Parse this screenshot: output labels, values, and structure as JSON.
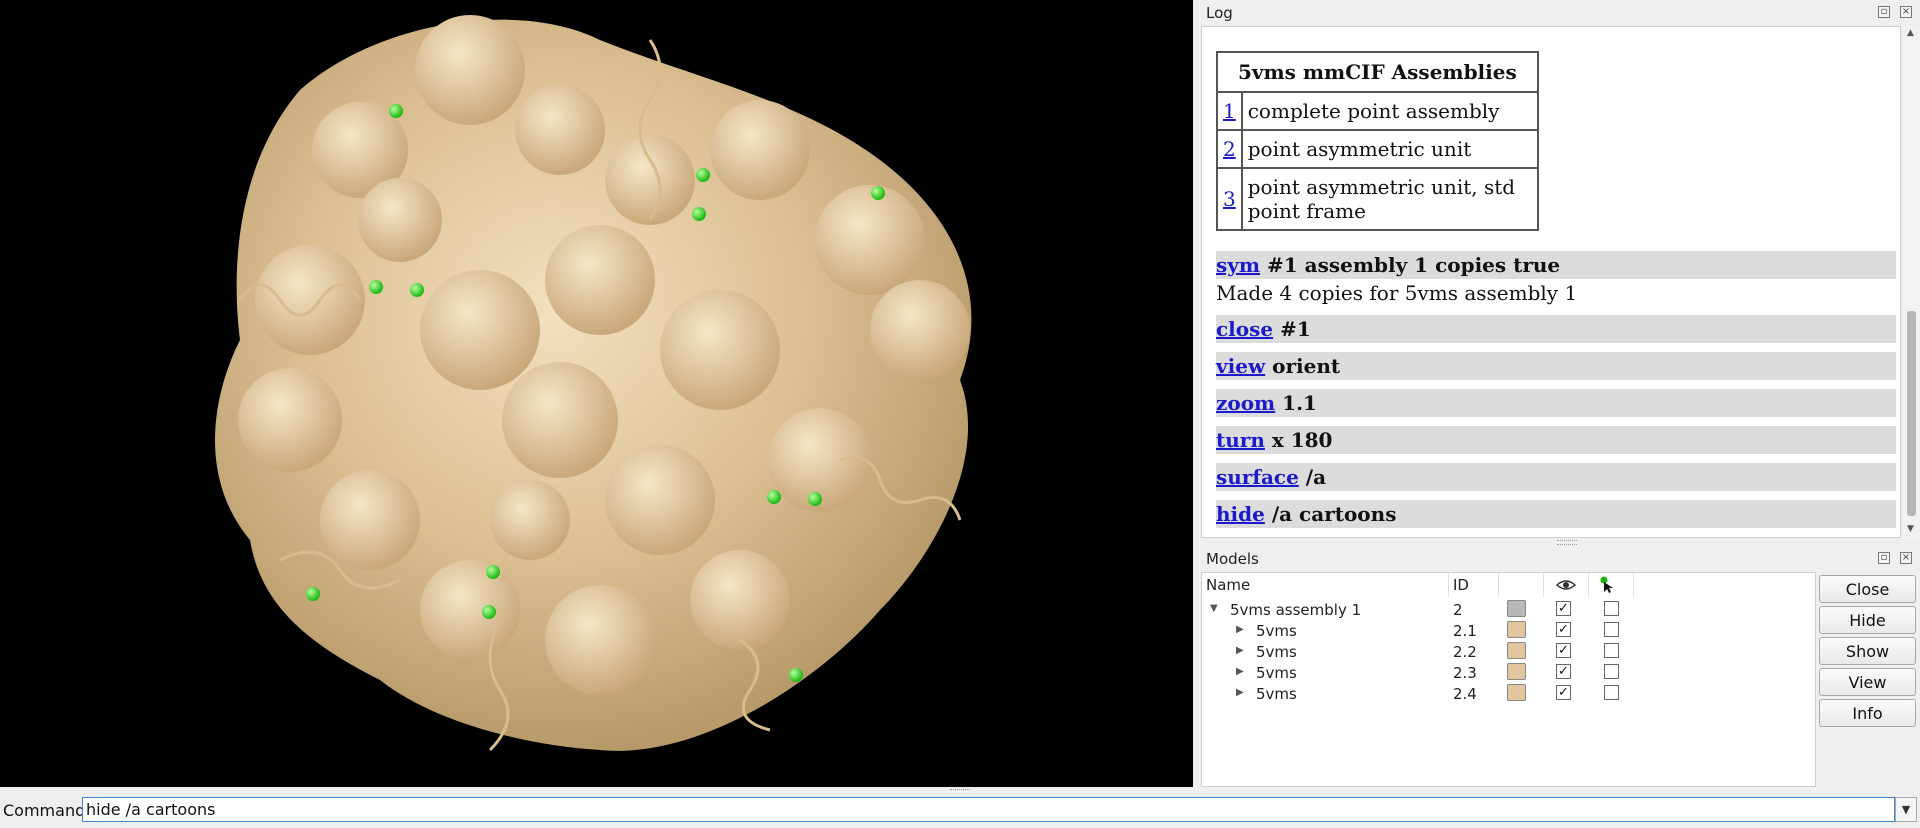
{
  "log": {
    "title": "Log",
    "assemblies": {
      "header": "5vms mmCIF Assemblies",
      "rows": [
        {
          "num": "1",
          "desc": "complete point assembly"
        },
        {
          "num": "2",
          "desc": "point asymmetric unit"
        },
        {
          "num": "3",
          "desc": "point asymmetric unit, std point frame"
        }
      ]
    },
    "commands": [
      {
        "cmd": "sym",
        "args": "#1 assembly 1 copies true"
      },
      {
        "cmd": "close",
        "args": "#1"
      },
      {
        "cmd": "view",
        "args": "orient"
      },
      {
        "cmd": "zoom",
        "args": "1.1"
      },
      {
        "cmd": "turn",
        "args": "x 180"
      },
      {
        "cmd": "surface",
        "args": "/a"
      },
      {
        "cmd": "hide",
        "args": "/a cartoons"
      }
    ],
    "output_line": "Made 4 copies for 5vms assembly 1"
  },
  "models": {
    "title": "Models",
    "columns": {
      "name": "Name",
      "id": "ID"
    },
    "rows": [
      {
        "name": "5vms assembly 1",
        "id": "2",
        "color": "#b8b8b8",
        "shown": "✓"
      },
      {
        "name": "5vms",
        "id": "2.1",
        "color": "#e2c79e",
        "shown": "✓"
      },
      {
        "name": "5vms",
        "id": "2.2",
        "color": "#e2c79e",
        "shown": "✓"
      },
      {
        "name": "5vms",
        "id": "2.3",
        "color": "#e2c79e",
        "shown": "✓"
      },
      {
        "name": "5vms",
        "id": "2.4",
        "color": "#e2c79e",
        "shown": "✓"
      }
    ],
    "buttons": {
      "close": "Close",
      "hide": "Hide",
      "show": "Show",
      "view": "View",
      "info": "Info"
    }
  },
  "command": {
    "label": "Command:",
    "value": "hide /a cartoons"
  },
  "icons": [
    "eye-icon",
    "pointer-icon",
    "float-icon",
    "close-icon",
    "chevron-down-icon",
    "expand-triangle-icon"
  ]
}
